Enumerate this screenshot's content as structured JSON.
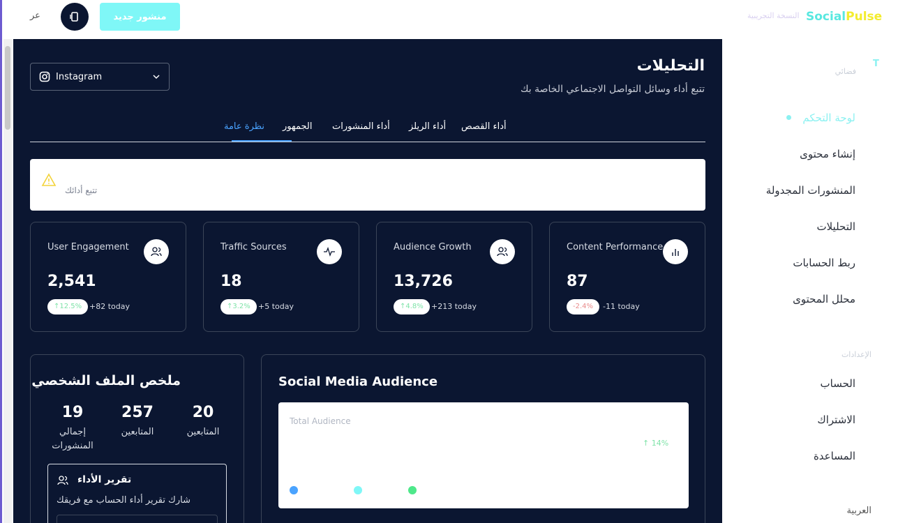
{
  "topbar": {
    "lang_label": "عر",
    "new_post_label": "منشور جديد"
  },
  "header": {
    "title": "التحليلات",
    "subtitle": "تتبع أداء وسائل التواصل الاجتماعي الخاصة بك",
    "platform_select": "Instagram"
  },
  "tabs": [
    {
      "label": "أداء القصص"
    },
    {
      "label": "أداء الريلز"
    },
    {
      "label": "أداء المنشورات"
    },
    {
      "label": "الجمهور"
    },
    {
      "label": "نظرة عامة",
      "active": true
    }
  ],
  "alert": {
    "text": "تتبع أدائك"
  },
  "metrics": [
    {
      "title": "User Engagement",
      "value": "2,541",
      "change": "↑12.5%",
      "today": "+82 today",
      "trend": "up",
      "icon": "users-icon"
    },
    {
      "title": "Traffic Sources",
      "value": "18",
      "change": "↑3.2%",
      "today": "+5 today",
      "trend": "up",
      "icon": "activity-icon"
    },
    {
      "title": "Audience Growth",
      "value": "13,726",
      "change": "↑4.8%",
      "today": "+213 today",
      "trend": "up",
      "icon": "users-icon"
    },
    {
      "title": "Content Performance",
      "value": "87",
      "change": "-2.4%",
      "today": "-11 today",
      "trend": "down",
      "icon": "bar-chart-icon"
    }
  ],
  "profile": {
    "title": "ملخص الملف الشخصي",
    "stats": [
      {
        "value": "19",
        "label": "إجمالي المنشورات"
      },
      {
        "value": "257",
        "label": "المتابعين"
      },
      {
        "value": "20",
        "label": "المتابعين"
      }
    ],
    "report": {
      "title": "تقرير الأداء",
      "description": "شارك تقرير أداء الحساب مع فريقك"
    }
  },
  "audience": {
    "title": "Social Media Audience",
    "total_label": "Total Audience",
    "change": "↑ 14%",
    "series_colors": [
      "#4aa3ff",
      "#7ff7f7",
      "#4ee88a"
    ]
  },
  "sidebar": {
    "brand_a": "Social",
    "brand_b": "Pulse",
    "version": "النسخة التجريبية",
    "section_main": "فضائي",
    "items": [
      {
        "label": "لوحة التحكم",
        "active": true
      },
      {
        "label": "إنشاء محتوى"
      },
      {
        "label": "المنشورات المجدولة"
      },
      {
        "label": "التحليلات"
      },
      {
        "label": "ربط الحسابات"
      },
      {
        "label": "محلل المحتوى"
      }
    ],
    "section_settings": "الإعدادات",
    "settings": [
      {
        "label": "الحساب"
      },
      {
        "label": "الاشتراك"
      },
      {
        "label": "المساعدة"
      }
    ],
    "language": "العربية"
  }
}
